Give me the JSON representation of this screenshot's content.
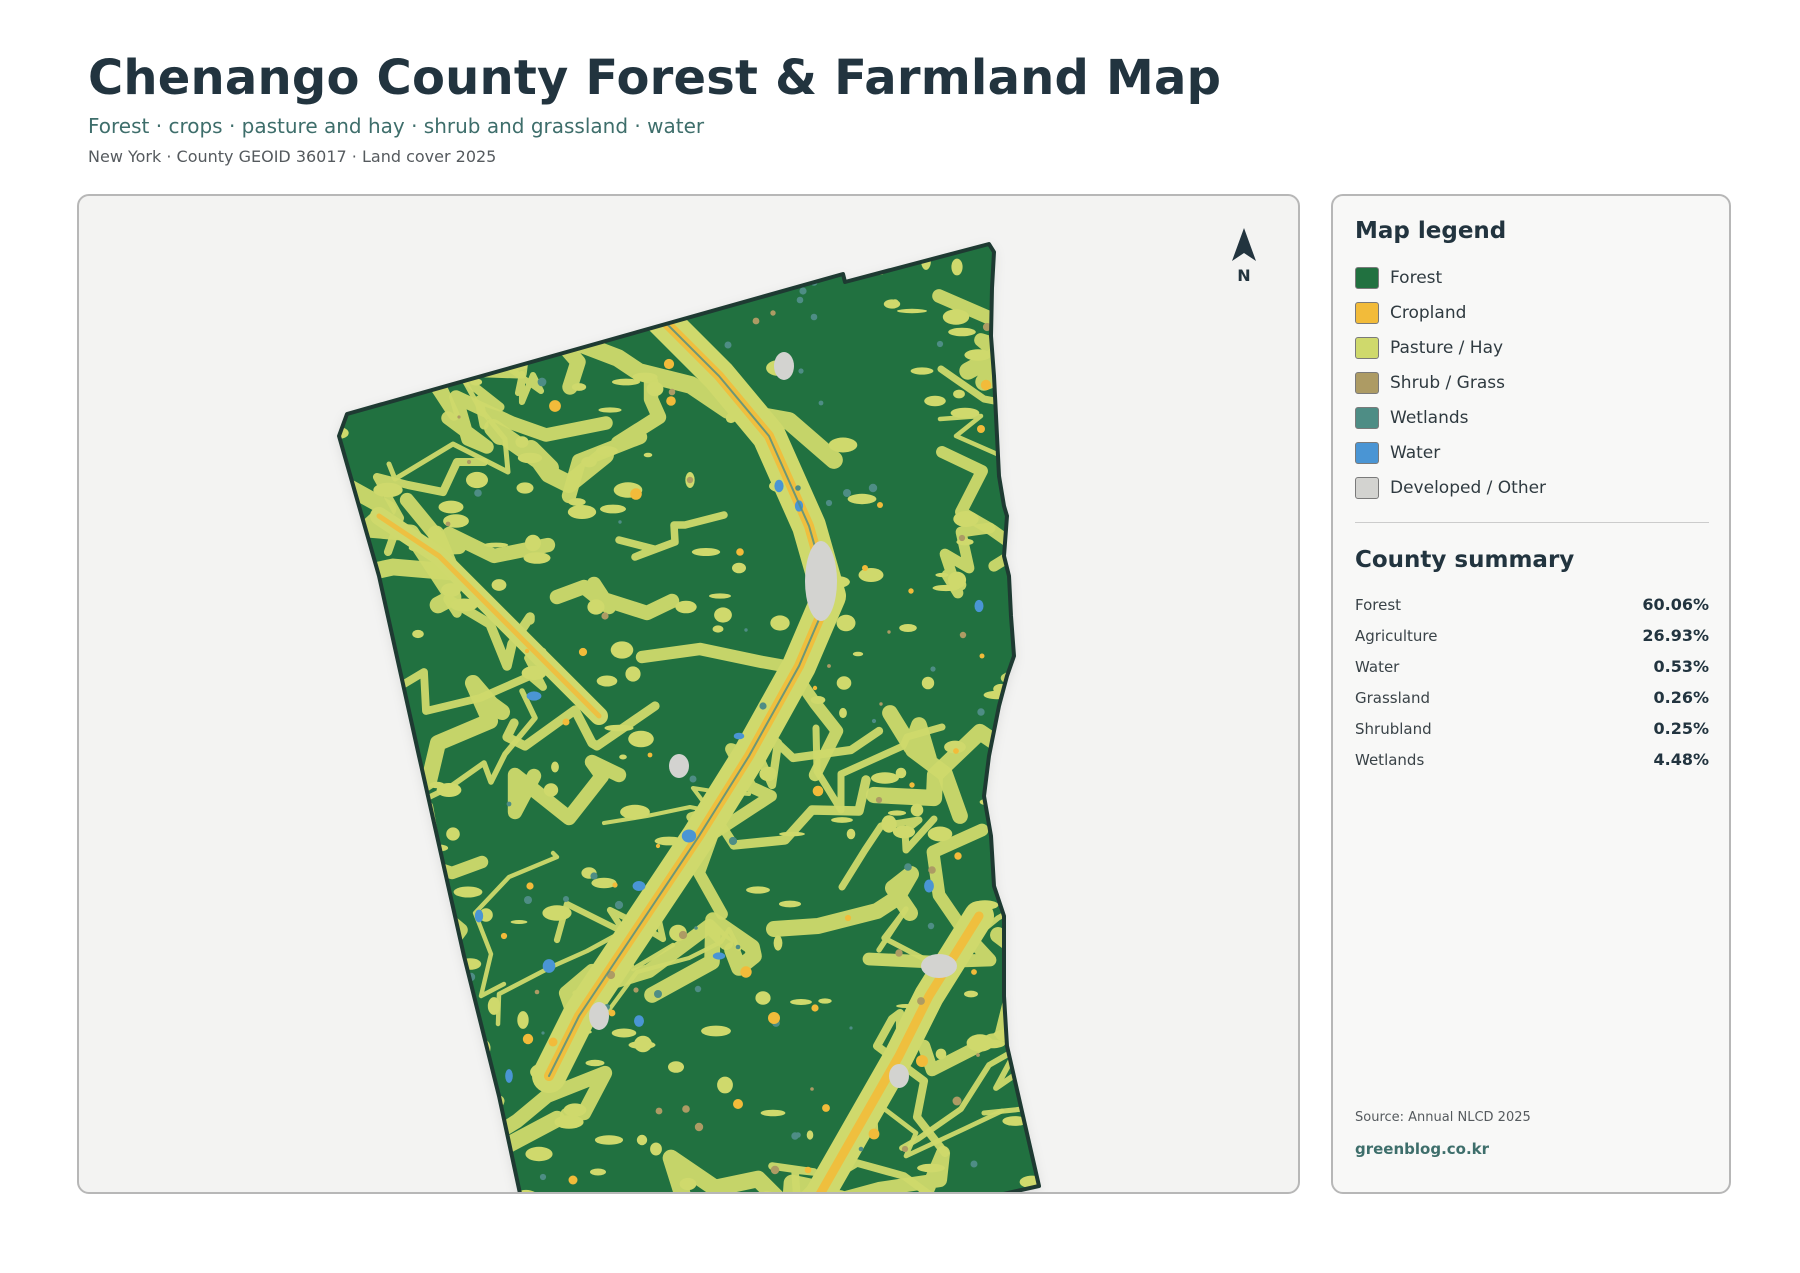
{
  "header": {
    "title": "Chenango County Forest & Farmland Map",
    "subtitle": "Forest · crops · pasture and hay · shrub and grassland · water",
    "meta": "New York · County GEOID 36017 · Land cover 2025"
  },
  "map": {
    "north_label": "N",
    "colors": {
      "forest": "#217140",
      "cropland": "#f2bb3a",
      "pasture": "#cfd96c",
      "shrub": "#ad9b64",
      "wetlands": "#4e8d85",
      "water": "#4a95d4",
      "developed": "#d3d3d0",
      "border": "#1e3a32"
    }
  },
  "legend": {
    "title": "Map legend",
    "items": [
      {
        "label": "Forest",
        "color": "#217140"
      },
      {
        "label": "Cropland",
        "color": "#f2bb3a"
      },
      {
        "label": "Pasture / Hay",
        "color": "#cfd96c"
      },
      {
        "label": "Shrub / Grass",
        "color": "#ad9b64"
      },
      {
        "label": "Wetlands",
        "color": "#4e8d85"
      },
      {
        "label": "Water",
        "color": "#4a95d4"
      },
      {
        "label": "Developed / Other",
        "color": "#d3d3d0"
      }
    ]
  },
  "summary": {
    "title": "County summary",
    "rows": [
      {
        "name": "Forest",
        "value": "60.06%"
      },
      {
        "name": "Agriculture",
        "value": "26.93%"
      },
      {
        "name": "Water",
        "value": "0.53%"
      },
      {
        "name": "Grassland",
        "value": "0.26%"
      },
      {
        "name": "Shrubland",
        "value": "0.25%"
      },
      {
        "name": "Wetlands",
        "value": "4.48%"
      }
    ]
  },
  "footer": {
    "source": "Source: Annual NLCD 2025",
    "site": "greenblog.co.kr"
  }
}
